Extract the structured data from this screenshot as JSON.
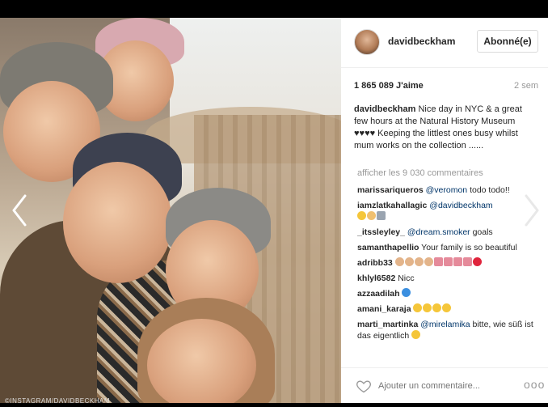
{
  "photo": {
    "watermark": "©INSTAGRAM/DAVIDBECKHAM"
  },
  "header": {
    "username": "davidbeckham",
    "follow_label": "Abonné(e)"
  },
  "stats": {
    "likes": "1 865 089 J'aime",
    "time": "2 sem"
  },
  "caption": {
    "user": "davidbeckham",
    "text": " Nice day in NYC & a great few hours at the Natural History Museum ♥♥♥♥ Keeping the littlest ones busy whilst mum works on the collection ......"
  },
  "view_all": "afficher les 9 030 commentaires",
  "comments": [
    {
      "user": "marissariqueros",
      "text": " ",
      "mention": "@veromon",
      "after": " todo todo!!"
    },
    {
      "user": "iamzlatkahallagic",
      "text": " ",
      "mention": "@davidbeckham",
      "after": ""
    },
    {
      "user": "_itssleyley_",
      "text": " ",
      "mention": "@dream.smoker",
      "after": " goals"
    },
    {
      "user": "samanthapellio",
      "text": " Your family is so beautiful",
      "mention": "",
      "after": ""
    },
    {
      "user": "adribb33",
      "text": "",
      "mention": "",
      "after": ""
    },
    {
      "user": "khlyl6582",
      "text": " Nicc",
      "mention": "",
      "after": ""
    },
    {
      "user": "azzaadilah",
      "text": "",
      "mention": "",
      "after": ""
    },
    {
      "user": "amani_karaja",
      "text": "",
      "mention": "",
      "after": ""
    },
    {
      "user": "marti_martinka",
      "text": " ",
      "mention": "@mirelamika",
      "after": " bitte, wie süß ist das eigentlich"
    }
  ],
  "footer": {
    "add_comment_placeholder": "Ajouter un commentaire...",
    "more_label": "ooo"
  },
  "icons": {
    "left_arrow": "chevron-left-icon",
    "right_arrow": "chevron-right-icon",
    "heart": "heart-icon",
    "more": "more-options-icon"
  },
  "colors": {
    "mention": "#003569",
    "follow_border": "#dbdbdb",
    "muted": "#999999"
  }
}
